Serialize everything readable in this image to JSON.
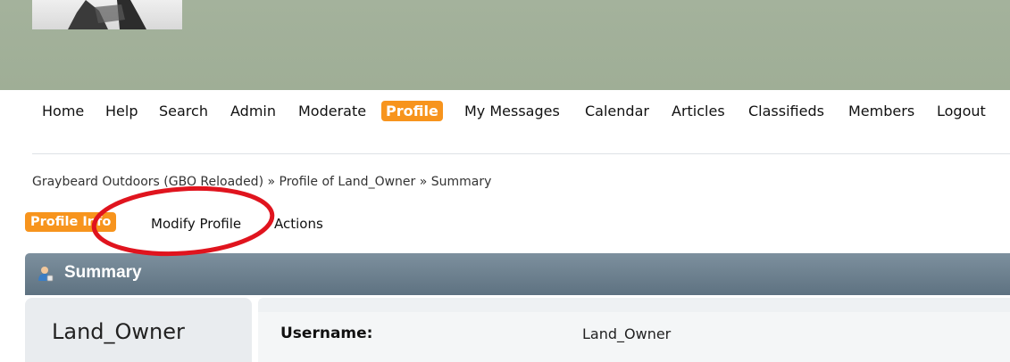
{
  "nav": {
    "items": [
      "Home",
      "Help",
      "Search",
      "Admin",
      "Moderate",
      "Profile",
      "My Messages",
      "Calendar",
      "Articles",
      "Classifieds",
      "Members",
      "Logout"
    ],
    "active": "Profile"
  },
  "breadcrumb": {
    "site": "Graybeard Outdoors (GBO Reloaded)",
    "profile": "Profile of Land_Owner",
    "current": "Summary",
    "separator": "»"
  },
  "subnav": {
    "profile_info": "Profile Info",
    "modify_profile": "Modify Profile",
    "actions": "Actions"
  },
  "section": {
    "title": "Summary",
    "icon": "user-icon"
  },
  "profile_card": {
    "display_name": "Land_Owner"
  },
  "fields": [
    {
      "label": "Username:",
      "value": "Land_Owner"
    }
  ],
  "colors": {
    "accent": "#f7941d",
    "banner": "#a4b29c",
    "section_header": "#6b7f8d",
    "annotation": "#e0141e"
  }
}
